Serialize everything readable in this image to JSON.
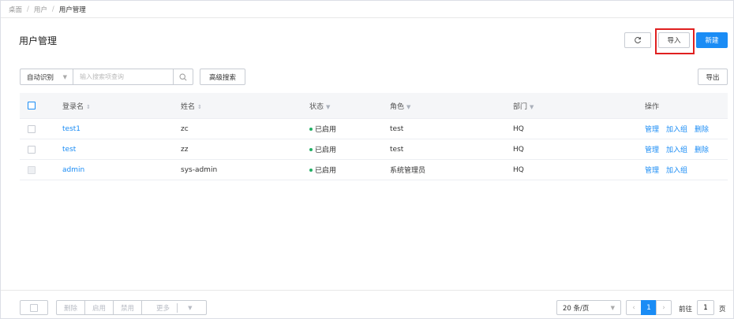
{
  "breadcrumb": [
    "桌面",
    "用户",
    "用户管理"
  ],
  "page_title": "用户管理",
  "toolbar": {
    "import_label": "导入",
    "new_label": "新建",
    "refresh_icon": "refresh-icon"
  },
  "search": {
    "mode": "自动识别",
    "placeholder": "输入搜索项查询",
    "advanced_label": "高级搜索",
    "export_label": "导出"
  },
  "table": {
    "headers": {
      "login": "登录名",
      "name": "姓名",
      "status": "状态",
      "role": "角色",
      "dept": "部门",
      "ops": "操作"
    },
    "rows": [
      {
        "login": "test1",
        "name": "zc",
        "status": "已启用",
        "role": "test",
        "dept": "HQ",
        "ops": [
          "管理",
          "加入组",
          "删除"
        ]
      },
      {
        "login": "test",
        "name": "zz",
        "status": "已启用",
        "role": "test",
        "dept": "HQ",
        "ops": [
          "管理",
          "加入组",
          "删除"
        ]
      },
      {
        "login": "admin",
        "name": "sys-admin",
        "status": "已启用",
        "role": "系统管理员",
        "dept": "HQ",
        "ops": [
          "管理",
          "加入组"
        ]
      }
    ]
  },
  "footer": {
    "batch": [
      "删除",
      "启用",
      "禁用",
      "更多"
    ],
    "page_size": "20 条/页",
    "current_page": "1",
    "goto_label": "前往",
    "goto_value": "1",
    "goto_suffix": "页"
  },
  "colors": {
    "primary": "#1a8cf5",
    "status_enabled": "#23b066",
    "highlight": "#e02020"
  }
}
